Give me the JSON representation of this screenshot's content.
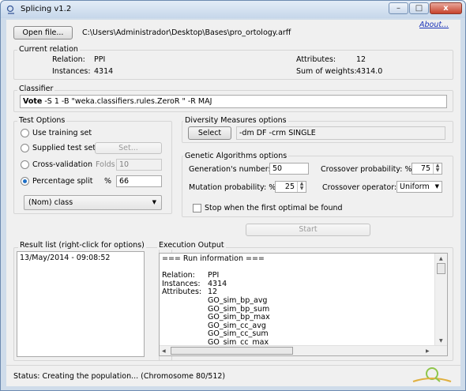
{
  "window": {
    "title": "Splicing v1.2",
    "minimize": "–",
    "maximize": "□",
    "close": "x"
  },
  "toolbar": {
    "open_button": "Open file...",
    "file_path": "C:\\Users\\Administrador\\Desktop\\Bases\\pro_ortology.arff",
    "about_link": "About..."
  },
  "relation": {
    "group_label": "Current relation",
    "relation_label": "Relation:",
    "relation_value": "PPI",
    "instances_label": "Instances:",
    "instances_value": "4314",
    "attributes_label": "Attributes:",
    "attributes_value": "12",
    "sum_weights_label": "Sum of weights:",
    "sum_weights_value": "4314.0"
  },
  "classifier": {
    "group_label": "Classifier",
    "name": "Vote",
    "args": " -S 1 -B \"weka.classifiers.rules.ZeroR \" -R MAJ"
  },
  "test_options": {
    "group_label": "Test Options",
    "use_training": "Use training set",
    "supplied_test": "Supplied test set",
    "set_button": "Set...",
    "cross_validation": "Cross-validation",
    "folds_label": "Folds",
    "folds_value": "10",
    "percentage_split": "Percentage split",
    "percent_label": "%",
    "percent_value": "66",
    "class_select": "(Nom) class"
  },
  "diversity": {
    "group_label": "Diversity Measures options",
    "select_button": "Select",
    "value": "-dm DF -crm SINGLE"
  },
  "ga": {
    "group_label": "Genetic Algorithms options",
    "generations_label": "Generation's number:",
    "generations_value": "50",
    "crossover_prob_label": "Crossover probability: %",
    "crossover_prob_value": "75",
    "mutation_label": "Mutation probability: %",
    "mutation_value": "25",
    "crossover_op_label": "Crossover operator:",
    "crossover_op_value": "Uniform",
    "stop_label": "Stop when the first optimal be found"
  },
  "start_button": "Start",
  "result_list": {
    "group_label": "Result list (right-click for options)",
    "items": [
      "13/May/2014 - 09:08:52"
    ]
  },
  "execution_output": {
    "group_label": "Execution Output",
    "lines": [
      {
        "k": "=== Run information ===",
        "v": ""
      },
      {
        "k": "",
        "v": ""
      },
      {
        "k": "Relation:",
        "v": "PPI"
      },
      {
        "k": "Instances:",
        "v": "4314"
      },
      {
        "k": "Attributes:",
        "v": "12"
      },
      {
        "k": "",
        "v": "GO_sim_bp_avg"
      },
      {
        "k": "",
        "v": "GO_sim_bp_sum"
      },
      {
        "k": "",
        "v": "GO_sim_bp_max"
      },
      {
        "k": "",
        "v": "GO_sim_cc_avg"
      },
      {
        "k": "",
        "v": "GO_sim_cc_sum"
      },
      {
        "k": "",
        "v": "GO_sim_cc_max"
      }
    ]
  },
  "status": {
    "text": "Status:  Creating the population... (Chromosome 80/512)"
  }
}
